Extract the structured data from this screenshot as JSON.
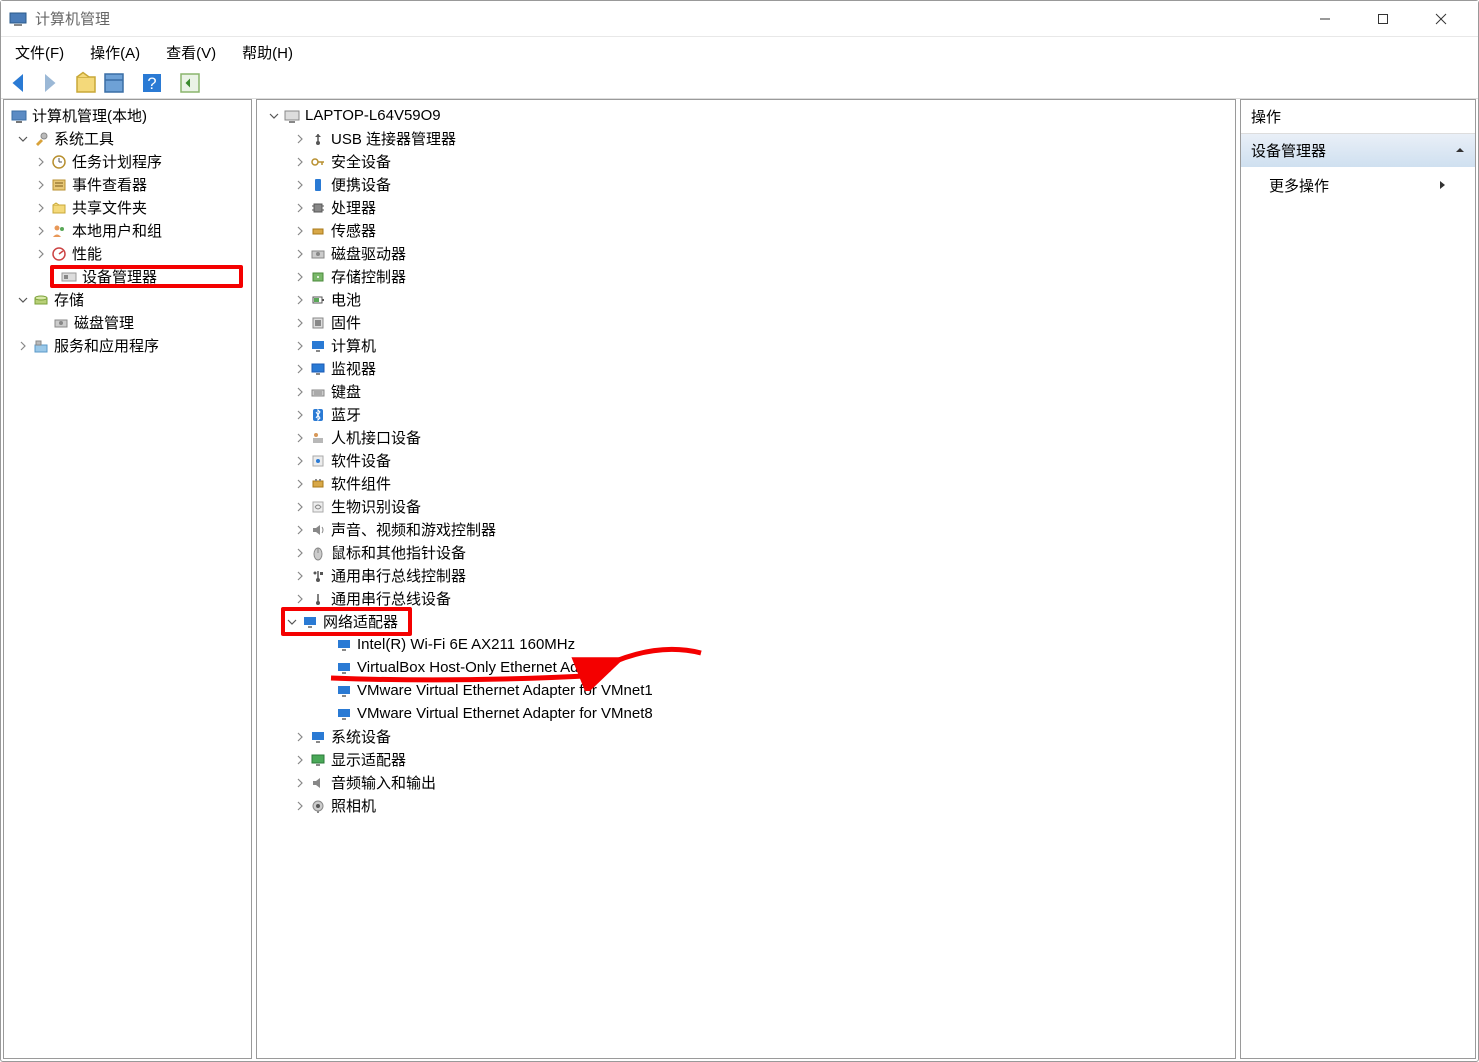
{
  "window": {
    "title": "计算机管理"
  },
  "menu": {
    "file": "文件(F)",
    "action": "操作(A)",
    "view": "查看(V)",
    "help": "帮助(H)"
  },
  "left_tree": {
    "root": "计算机管理(本地)",
    "group_system": "系统工具",
    "items_system": [
      "任务计划程序",
      "事件查看器",
      "共享文件夹",
      "本地用户和组",
      "性能",
      "设备管理器"
    ],
    "group_storage": "存储",
    "items_storage": [
      "磁盘管理"
    ],
    "group_services": "服务和应用程序"
  },
  "device_tree": {
    "root": "LAPTOP-L64V59O9",
    "categories": [
      {
        "label": "USB 连接器管理器",
        "icon": "usb"
      },
      {
        "label": "安全设备",
        "icon": "key"
      },
      {
        "label": "便携设备",
        "icon": "phone"
      },
      {
        "label": "处理器",
        "icon": "cpu"
      },
      {
        "label": "传感器",
        "icon": "sensor"
      },
      {
        "label": "磁盘驱动器",
        "icon": "disk"
      },
      {
        "label": "存储控制器",
        "icon": "storage"
      },
      {
        "label": "电池",
        "icon": "battery"
      },
      {
        "label": "固件",
        "icon": "firmware"
      },
      {
        "label": "计算机",
        "icon": "computer"
      },
      {
        "label": "监视器",
        "icon": "monitor"
      },
      {
        "label": "键盘",
        "icon": "keyboard"
      },
      {
        "label": "蓝牙",
        "icon": "bluetooth"
      },
      {
        "label": "人机接口设备",
        "icon": "hid"
      },
      {
        "label": "软件设备",
        "icon": "software"
      },
      {
        "label": "软件组件",
        "icon": "component"
      },
      {
        "label": "生物识别设备",
        "icon": "biometric"
      },
      {
        "label": "声音、视频和游戏控制器",
        "icon": "sound"
      },
      {
        "label": "鼠标和其他指针设备",
        "icon": "mouse"
      },
      {
        "label": "通用串行总线控制器",
        "icon": "usbctrl"
      },
      {
        "label": "通用串行总线设备",
        "icon": "usbdev"
      }
    ],
    "network_adapter": {
      "label": "网络适配器",
      "children": [
        "Intel(R) Wi-Fi 6E AX211 160MHz",
        "VirtualBox Host-Only Ethernet Adapter",
        "VMware Virtual Ethernet Adapter for VMnet1",
        "VMware Virtual Ethernet Adapter for VMnet8"
      ]
    },
    "categories_after": [
      {
        "label": "系统设备",
        "icon": "system"
      },
      {
        "label": "显示适配器",
        "icon": "display"
      },
      {
        "label": "音频输入和输出",
        "icon": "audio"
      },
      {
        "label": "照相机",
        "icon": "camera"
      }
    ]
  },
  "actions": {
    "header": "操作",
    "subheader": "设备管理器",
    "more": "更多操作"
  }
}
